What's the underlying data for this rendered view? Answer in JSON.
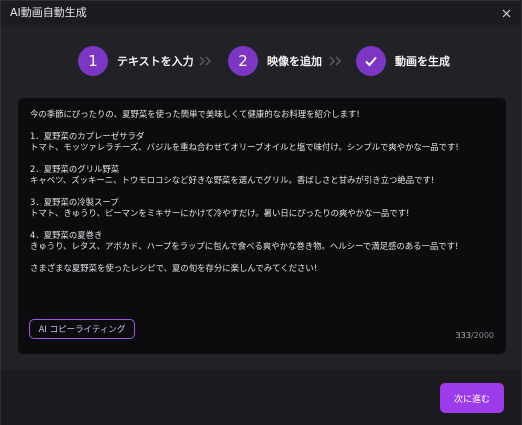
{
  "window": {
    "title": "AI動画自動生成"
  },
  "steps": [
    {
      "number": "1",
      "label": "テキストを入力"
    },
    {
      "number": "2",
      "label": "映像を追加"
    },
    {
      "number": "",
      "label": "動画を生成",
      "icon": "check-icon"
    }
  ],
  "editor": {
    "text": "今の季節にぴったりの、夏野菜を使った簡単で美味しくて健康的なお料理を紹介します!\n\n1．夏野菜のカプレーゼサラダ\nトマト、モッツァレラチーズ、バジルを重ね合わせてオリーブオイルと塩で味付け。シンプルで爽やかな一品です!\n\n2．夏野菜のグリル野菜\nキャベツ、ズッキーニ、トウモロコシなど好きな野菜を選んでグリル。香ばしさと甘みが引き立つ絶品です!\n\n3．夏野菜の冷製スープ\nトマト、きゅうり、ピーマンをミキサーにかけて冷やすだけ。暑い日にぴったりの爽やかな一品です!\n\n4．夏野菜の夏巻き\nきゅうり、レタス、アボカド、ハープをラップに包んで食べる爽やかな巻き物。ヘルシーで満足感のある一品です!\n\nさまざまな夏野菜を使ったレシピで、夏の旬を存分に楽しんでみてください!",
    "ai_button_label": "AI コピーライティング",
    "char_count": "333",
    "char_limit": "/2000"
  },
  "footer": {
    "next_label": "次に進む"
  },
  "colors": {
    "accent": "#7d35c4",
    "button": "#9c3bea",
    "background": "#222226",
    "editor_bg": "#0c0c0e"
  }
}
